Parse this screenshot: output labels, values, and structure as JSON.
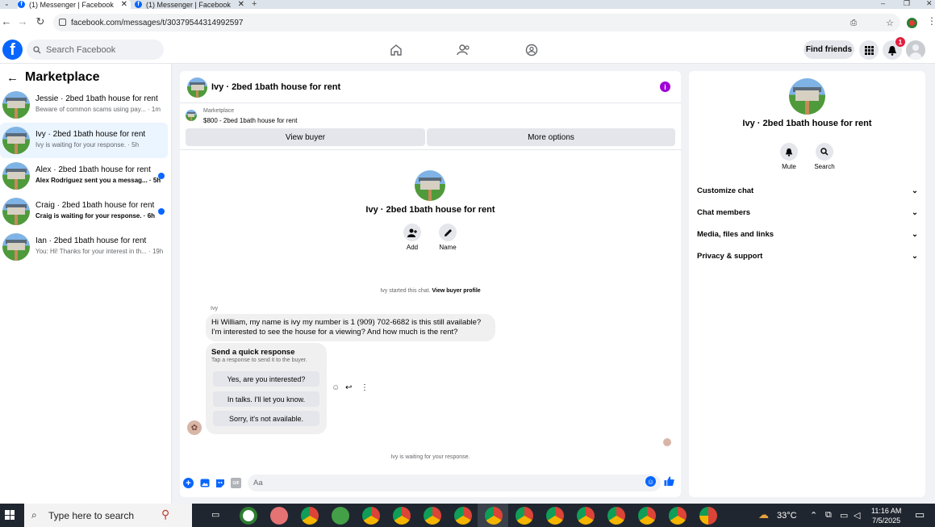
{
  "browser": {
    "tabs": [
      {
        "title": "(1) Messenger | Facebook",
        "active": true
      },
      {
        "title": "(1) Messenger | Facebook",
        "active": false
      }
    ],
    "url": "facebook.com/messages/t/30379544314992597",
    "new_tab_symbol": "+",
    "close_symbol": "✕",
    "window_controls": [
      "–",
      "❐",
      "✕"
    ]
  },
  "header": {
    "logo": "f",
    "search_placeholder": "Search Facebook",
    "find_friends_label": "Find friends",
    "notification_count": "1",
    "icons": [
      "home-icon",
      "friends-icon",
      "groups-icon",
      "menu-grid-icon",
      "bell-icon",
      "profile-avatar"
    ]
  },
  "sidebar": {
    "title": "Marketplace",
    "conversations": [
      {
        "name": "Jessie · 2bed 1bath house for rent",
        "preview": "Beware of common scams using pay... · 1m",
        "unread": false,
        "selected": false
      },
      {
        "name": "Ivy · 2bed 1bath house for rent",
        "preview": "Ivy is waiting for your response. · 5h",
        "unread": false,
        "selected": true
      },
      {
        "name": "Alex · 2bed 1bath house for rent",
        "preview": "Alex Rodriguez sent you a messag... · 5h",
        "unread": true,
        "selected": false
      },
      {
        "name": "Craig · 2bed 1bath house for rent",
        "preview": "Craig is waiting for your response. · 6h",
        "unread": true,
        "selected": false
      },
      {
        "name": "Ian · 2bed 1bath house for rent",
        "preview": "You: Hi! Thanks for your interest in th... · 19h",
        "unread": false,
        "selected": false
      }
    ]
  },
  "chat": {
    "title": "Ivy · 2bed 1bath house for rent",
    "marketplace_label": "Marketplace",
    "listing": "$800 - 2bed 1bath house for rent",
    "view_buyer_label": "View buyer",
    "more_options_label": "More options",
    "profile_name": "Ivy · 2bed 1bath house for rent",
    "add_label": "Add",
    "name_label": "Name",
    "started_text": "Ivy started this chat.",
    "view_profile_link": "View buyer profile",
    "sender": "Ivy",
    "message": "Hi William, my name is ivy my number is 1 (909) 702-6682 is this still available? I'm interested to see the house for a viewing? And how much is the rent?",
    "quick_title": "Send a quick response",
    "quick_subtitle": "Tap a response to send it to the buyer.",
    "quick_responses": [
      "Yes, are you interested?",
      "In talks. I'll let you know.",
      "Sorry, it's not available."
    ],
    "waiting_text": "Ivy is waiting for your response.",
    "input_placeholder": "Aa"
  },
  "details": {
    "name": "Ivy · 2bed 1bath house for rent",
    "mute_label": "Mute",
    "search_label": "Search",
    "sections": [
      "Customize chat",
      "Chat members",
      "Media, files and links",
      "Privacy & support"
    ]
  },
  "taskbar": {
    "search_placeholder": "Type here to search",
    "temperature": "33°C",
    "time": "11:16 AM",
    "date": "7/5/2025"
  },
  "colors": {
    "brand": "#0866ff",
    "selected_bg": "#ebf5ff",
    "info": "#a000d8"
  }
}
